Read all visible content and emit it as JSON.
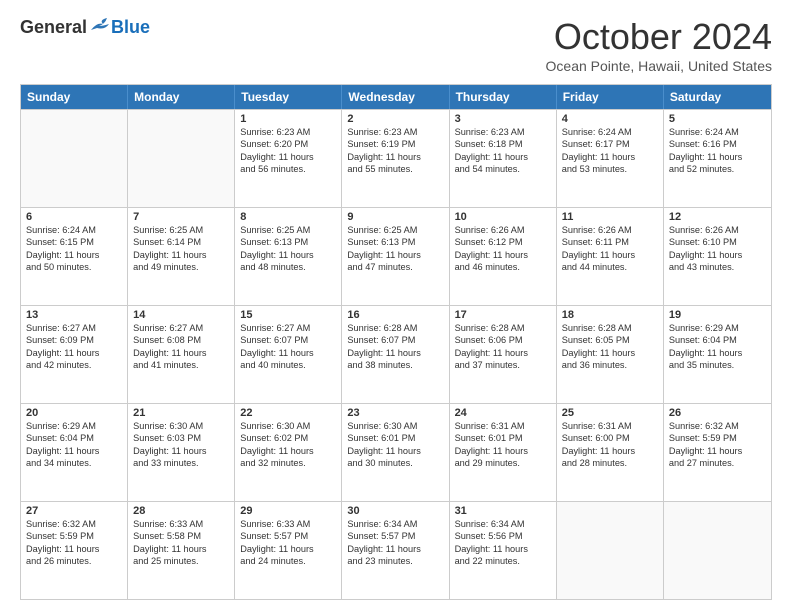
{
  "logo": {
    "general": "General",
    "blue": "Blue"
  },
  "title": "October 2024",
  "location": "Ocean Pointe, Hawaii, United States",
  "days_of_week": [
    "Sunday",
    "Monday",
    "Tuesday",
    "Wednesday",
    "Thursday",
    "Friday",
    "Saturday"
  ],
  "weeks": [
    [
      {
        "day": "",
        "empty": true,
        "lines": []
      },
      {
        "day": "",
        "empty": true,
        "lines": []
      },
      {
        "day": "1",
        "lines": [
          "Sunrise: 6:23 AM",
          "Sunset: 6:20 PM",
          "Daylight: 11 hours",
          "and 56 minutes."
        ]
      },
      {
        "day": "2",
        "lines": [
          "Sunrise: 6:23 AM",
          "Sunset: 6:19 PM",
          "Daylight: 11 hours",
          "and 55 minutes."
        ]
      },
      {
        "day": "3",
        "lines": [
          "Sunrise: 6:23 AM",
          "Sunset: 6:18 PM",
          "Daylight: 11 hours",
          "and 54 minutes."
        ]
      },
      {
        "day": "4",
        "lines": [
          "Sunrise: 6:24 AM",
          "Sunset: 6:17 PM",
          "Daylight: 11 hours",
          "and 53 minutes."
        ]
      },
      {
        "day": "5",
        "lines": [
          "Sunrise: 6:24 AM",
          "Sunset: 6:16 PM",
          "Daylight: 11 hours",
          "and 52 minutes."
        ]
      }
    ],
    [
      {
        "day": "6",
        "lines": [
          "Sunrise: 6:24 AM",
          "Sunset: 6:15 PM",
          "Daylight: 11 hours",
          "and 50 minutes."
        ]
      },
      {
        "day": "7",
        "lines": [
          "Sunrise: 6:25 AM",
          "Sunset: 6:14 PM",
          "Daylight: 11 hours",
          "and 49 minutes."
        ]
      },
      {
        "day": "8",
        "lines": [
          "Sunrise: 6:25 AM",
          "Sunset: 6:13 PM",
          "Daylight: 11 hours",
          "and 48 minutes."
        ]
      },
      {
        "day": "9",
        "lines": [
          "Sunrise: 6:25 AM",
          "Sunset: 6:13 PM",
          "Daylight: 11 hours",
          "and 47 minutes."
        ]
      },
      {
        "day": "10",
        "lines": [
          "Sunrise: 6:26 AM",
          "Sunset: 6:12 PM",
          "Daylight: 11 hours",
          "and 46 minutes."
        ]
      },
      {
        "day": "11",
        "lines": [
          "Sunrise: 6:26 AM",
          "Sunset: 6:11 PM",
          "Daylight: 11 hours",
          "and 44 minutes."
        ]
      },
      {
        "day": "12",
        "lines": [
          "Sunrise: 6:26 AM",
          "Sunset: 6:10 PM",
          "Daylight: 11 hours",
          "and 43 minutes."
        ]
      }
    ],
    [
      {
        "day": "13",
        "lines": [
          "Sunrise: 6:27 AM",
          "Sunset: 6:09 PM",
          "Daylight: 11 hours",
          "and 42 minutes."
        ]
      },
      {
        "day": "14",
        "lines": [
          "Sunrise: 6:27 AM",
          "Sunset: 6:08 PM",
          "Daylight: 11 hours",
          "and 41 minutes."
        ]
      },
      {
        "day": "15",
        "lines": [
          "Sunrise: 6:27 AM",
          "Sunset: 6:07 PM",
          "Daylight: 11 hours",
          "and 40 minutes."
        ]
      },
      {
        "day": "16",
        "lines": [
          "Sunrise: 6:28 AM",
          "Sunset: 6:07 PM",
          "Daylight: 11 hours",
          "and 38 minutes."
        ]
      },
      {
        "day": "17",
        "lines": [
          "Sunrise: 6:28 AM",
          "Sunset: 6:06 PM",
          "Daylight: 11 hours",
          "and 37 minutes."
        ]
      },
      {
        "day": "18",
        "lines": [
          "Sunrise: 6:28 AM",
          "Sunset: 6:05 PM",
          "Daylight: 11 hours",
          "and 36 minutes."
        ]
      },
      {
        "day": "19",
        "lines": [
          "Sunrise: 6:29 AM",
          "Sunset: 6:04 PM",
          "Daylight: 11 hours",
          "and 35 minutes."
        ]
      }
    ],
    [
      {
        "day": "20",
        "lines": [
          "Sunrise: 6:29 AM",
          "Sunset: 6:04 PM",
          "Daylight: 11 hours",
          "and 34 minutes."
        ]
      },
      {
        "day": "21",
        "lines": [
          "Sunrise: 6:30 AM",
          "Sunset: 6:03 PM",
          "Daylight: 11 hours",
          "and 33 minutes."
        ]
      },
      {
        "day": "22",
        "lines": [
          "Sunrise: 6:30 AM",
          "Sunset: 6:02 PM",
          "Daylight: 11 hours",
          "and 32 minutes."
        ]
      },
      {
        "day": "23",
        "lines": [
          "Sunrise: 6:30 AM",
          "Sunset: 6:01 PM",
          "Daylight: 11 hours",
          "and 30 minutes."
        ]
      },
      {
        "day": "24",
        "lines": [
          "Sunrise: 6:31 AM",
          "Sunset: 6:01 PM",
          "Daylight: 11 hours",
          "and 29 minutes."
        ]
      },
      {
        "day": "25",
        "lines": [
          "Sunrise: 6:31 AM",
          "Sunset: 6:00 PM",
          "Daylight: 11 hours",
          "and 28 minutes."
        ]
      },
      {
        "day": "26",
        "lines": [
          "Sunrise: 6:32 AM",
          "Sunset: 5:59 PM",
          "Daylight: 11 hours",
          "and 27 minutes."
        ]
      }
    ],
    [
      {
        "day": "27",
        "lines": [
          "Sunrise: 6:32 AM",
          "Sunset: 5:59 PM",
          "Daylight: 11 hours",
          "and 26 minutes."
        ]
      },
      {
        "day": "28",
        "lines": [
          "Sunrise: 6:33 AM",
          "Sunset: 5:58 PM",
          "Daylight: 11 hours",
          "and 25 minutes."
        ]
      },
      {
        "day": "29",
        "lines": [
          "Sunrise: 6:33 AM",
          "Sunset: 5:57 PM",
          "Daylight: 11 hours",
          "and 24 minutes."
        ]
      },
      {
        "day": "30",
        "lines": [
          "Sunrise: 6:34 AM",
          "Sunset: 5:57 PM",
          "Daylight: 11 hours",
          "and 23 minutes."
        ]
      },
      {
        "day": "31",
        "lines": [
          "Sunrise: 6:34 AM",
          "Sunset: 5:56 PM",
          "Daylight: 11 hours",
          "and 22 minutes."
        ]
      },
      {
        "day": "",
        "empty": true,
        "lines": []
      },
      {
        "day": "",
        "empty": true,
        "lines": []
      }
    ]
  ]
}
